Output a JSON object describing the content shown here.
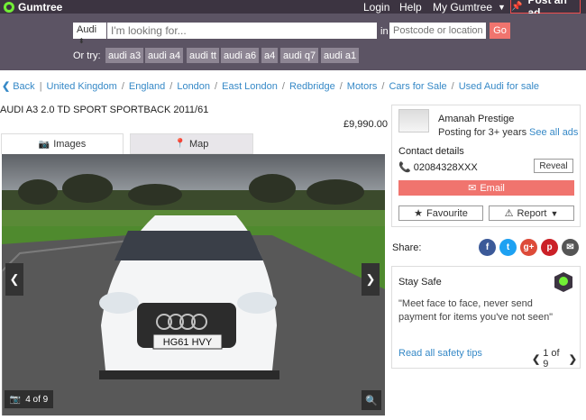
{
  "topbar": {
    "logo": "Gumtree",
    "login": "Login",
    "help": "Help",
    "my_gumtree": "My Gumtree",
    "post_ad": "Post an ad"
  },
  "search": {
    "category": "Audi",
    "placeholder": "I'm looking for...",
    "in_label": "in",
    "location_placeholder": "Postcode or location",
    "go": "Go",
    "or_try": "Or try:",
    "suggestions": [
      "audi a3",
      "audi a4",
      "audi tt",
      "audi a6",
      "a4",
      "audi q7",
      "audi a1"
    ]
  },
  "breadcrumb": {
    "back": "Back",
    "items": [
      "United Kingdom",
      "England",
      "London",
      "East London",
      "Redbridge",
      "Motors",
      "Cars for Sale",
      "Used Audi for sale"
    ]
  },
  "listing": {
    "title": "AUDI A3 2.0 TD SPORT SPORTBACK 2011/61",
    "price": "£9,990.00",
    "tab_images": "Images",
    "tab_map": "Map",
    "photo_counter": "4 of 9",
    "plate": "HG61 HVY"
  },
  "seller": {
    "name": "Amanah Prestige",
    "posting": "Posting for 3+ years",
    "see_all": "See all ads",
    "contact_title": "Contact details",
    "phone": "02084328XXX",
    "reveal": "Reveal",
    "email": "Email",
    "favourite": "Favourite",
    "report": "Report"
  },
  "share": {
    "label": "Share:",
    "icons": [
      {
        "name": "facebook",
        "glyph": "f",
        "color": "#3b5998"
      },
      {
        "name": "twitter",
        "glyph": "t",
        "color": "#1da1f2"
      },
      {
        "name": "google-plus",
        "glyph": "g+",
        "color": "#dd4b39"
      },
      {
        "name": "pinterest",
        "glyph": "p",
        "color": "#cb2027"
      },
      {
        "name": "email",
        "glyph": "✉",
        "color": "#555555"
      }
    ]
  },
  "safety": {
    "title": "Stay Safe",
    "quote": "\"Meet face to face, never send payment for items you've not seen\"",
    "link": "Read all safety tips",
    "pager": "1 of 9"
  },
  "colors": {
    "topbar": "#3c3441",
    "searchbar": "#5c5464",
    "link": "#3689c7",
    "accent": "#f0746e"
  }
}
